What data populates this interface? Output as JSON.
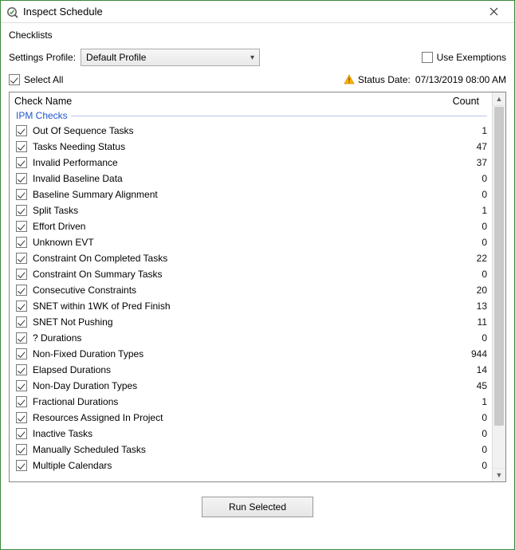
{
  "window": {
    "title": "Inspect Schedule"
  },
  "subheader": "Checklists",
  "settingsProfile": {
    "label": "Settings Profile:",
    "value": "Default Profile"
  },
  "useExemptions": {
    "label": "Use Exemptions",
    "checked": false
  },
  "selectAll": {
    "label": "Select All",
    "checked": true
  },
  "statusDate": {
    "label": "Status Date:",
    "value": "07/13/2019 08:00 AM"
  },
  "grid": {
    "headers": {
      "name": "Check Name",
      "count": "Count"
    },
    "group": "IPM Checks",
    "rows": [
      {
        "label": "Out Of Sequence Tasks",
        "count": "1",
        "checked": true
      },
      {
        "label": "Tasks Needing Status",
        "count": "47",
        "checked": true
      },
      {
        "label": "Invalid Performance",
        "count": "37",
        "checked": true
      },
      {
        "label": "Invalid Baseline Data",
        "count": "0",
        "checked": true
      },
      {
        "label": "Baseline Summary Alignment",
        "count": "0",
        "checked": true
      },
      {
        "label": "Split Tasks",
        "count": "1",
        "checked": true
      },
      {
        "label": "Effort Driven",
        "count": "0",
        "checked": true
      },
      {
        "label": "Unknown EVT",
        "count": "0",
        "checked": true
      },
      {
        "label": "Constraint On Completed Tasks",
        "count": "22",
        "checked": true
      },
      {
        "label": "Constraint On Summary Tasks",
        "count": "0",
        "checked": true
      },
      {
        "label": "Consecutive Constraints",
        "count": "20",
        "checked": true
      },
      {
        "label": "SNET within 1WK of Pred Finish",
        "count": "13",
        "checked": true
      },
      {
        "label": "SNET Not Pushing",
        "count": "11",
        "checked": true
      },
      {
        "label": "? Durations",
        "count": "0",
        "checked": true
      },
      {
        "label": "Non-Fixed Duration Types",
        "count": "944",
        "checked": true
      },
      {
        "label": "Elapsed Durations",
        "count": "14",
        "checked": true
      },
      {
        "label": "Non-Day Duration Types",
        "count": "45",
        "checked": true
      },
      {
        "label": "Fractional Durations",
        "count": "1",
        "checked": true
      },
      {
        "label": "Resources Assigned In Project",
        "count": "0",
        "checked": true
      },
      {
        "label": "Inactive Tasks",
        "count": "0",
        "checked": true
      },
      {
        "label": "Manually Scheduled Tasks",
        "count": "0",
        "checked": true
      },
      {
        "label": "Multiple Calendars",
        "count": "0",
        "checked": true
      }
    ]
  },
  "runButton": "Run Selected"
}
